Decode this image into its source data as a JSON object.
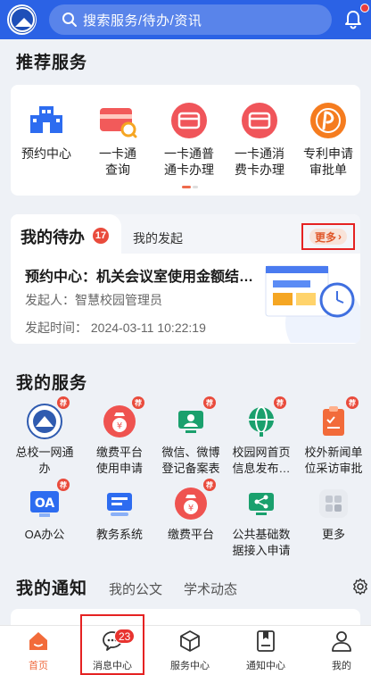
{
  "header": {
    "search_placeholder": "搜索服务/待办/资讯"
  },
  "recommended": {
    "title": "推荐服务",
    "items": [
      {
        "label": "预约中心",
        "icon": "building-icon"
      },
      {
        "label": "一卡通查询",
        "icon": "card-search-icon"
      },
      {
        "label": "一卡通普通卡办理",
        "icon": "card-icon"
      },
      {
        "label": "一卡通消费卡办理",
        "icon": "card-icon"
      },
      {
        "label": "专利申请审批单",
        "icon": "patent-icon"
      }
    ]
  },
  "todo": {
    "title": "我的待办",
    "badge": "17",
    "tab2": "我的发起",
    "more": "更多",
    "item": {
      "title": "预约中心：机关会议室使用金额结…",
      "initiator": "发起人：智慧校园管理员",
      "time": "发起时间：  2024-03-11 10:22:19"
    }
  },
  "services": {
    "title": "我的服务",
    "hot_label": "荐",
    "items": [
      {
        "label": "总校一网通办",
        "icon": "school-logo-icon",
        "hot": true
      },
      {
        "label": "缴费平台使用申请",
        "icon": "payment-bag-icon",
        "hot": true
      },
      {
        "label": "微信、微博登记备案表",
        "icon": "person-screen-icon",
        "hot": true
      },
      {
        "label": "校园网首页信息发布…",
        "icon": "globe-icon",
        "hot": true
      },
      {
        "label": "校外新闻单位采访审批",
        "icon": "clipboard-icon",
        "hot": true
      },
      {
        "label": "OA办公",
        "icon": "oa-icon",
        "hot": true
      },
      {
        "label": "教务系统",
        "icon": "teaching-icon",
        "hot": false
      },
      {
        "label": "缴费平台",
        "icon": "payment-bag-icon",
        "hot": true
      },
      {
        "label": "公共基础数据接入申请",
        "icon": "share-screen-icon",
        "hot": false
      },
      {
        "label": "更多",
        "icon": "grid-more-icon",
        "hot": false
      }
    ]
  },
  "notices": {
    "title": "我的通知",
    "tab2": "我的公文",
    "tab3": "学术动态"
  },
  "bottom_nav": {
    "items": [
      {
        "label": "首页"
      },
      {
        "label": "消息中心"
      },
      {
        "label": "服务中心"
      },
      {
        "label": "通知中心"
      },
      {
        "label": "我的"
      }
    ],
    "message_badge": "23"
  },
  "colors": {
    "header": "#2b62e5",
    "accent": "#ef6a3e",
    "highlight_box": "#e52222"
  }
}
